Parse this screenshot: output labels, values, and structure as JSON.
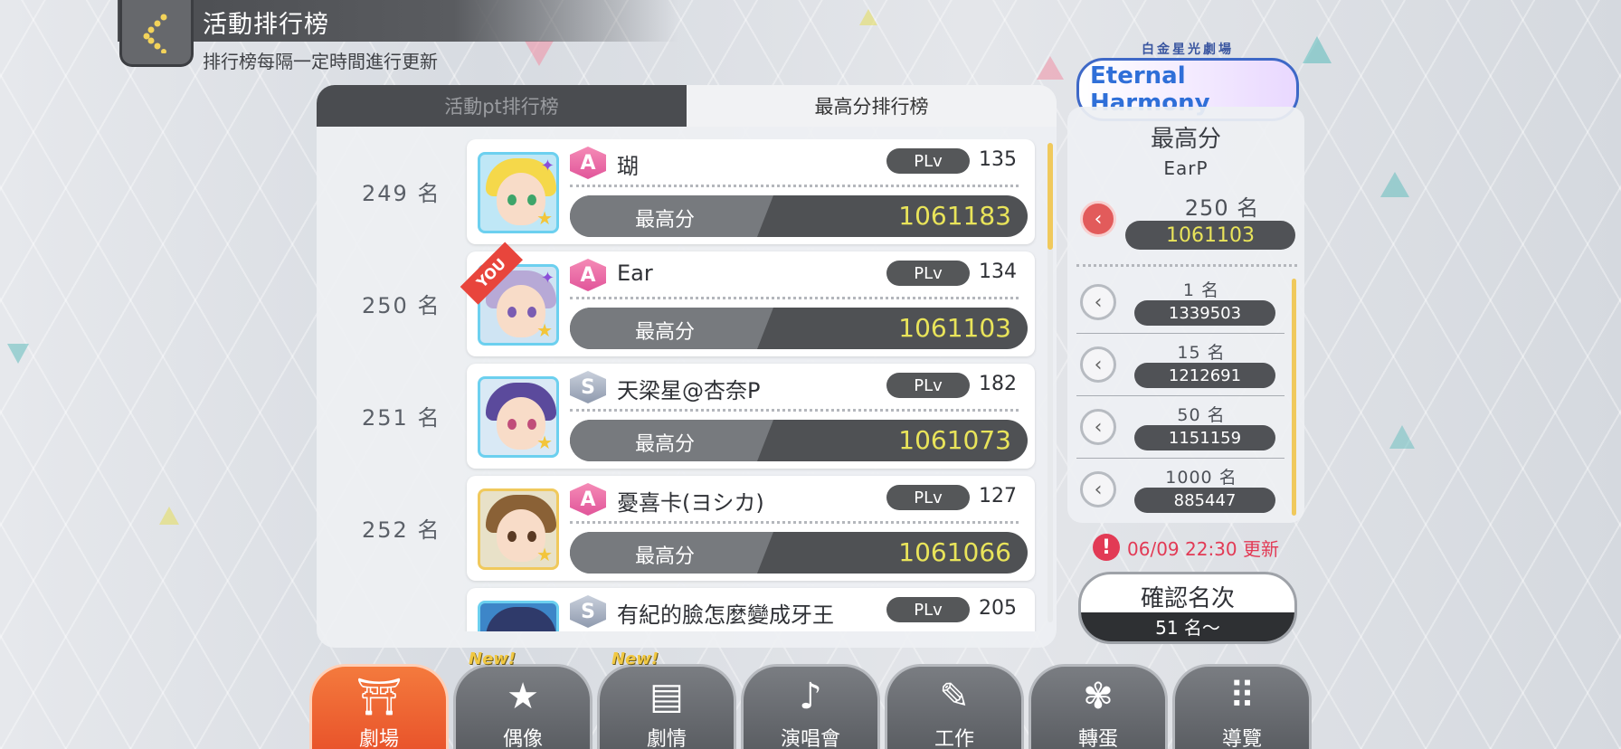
{
  "header": {
    "title": "活動排行榜",
    "subtitle": "排行榜每隔一定時間進行更新"
  },
  "tabs": [
    {
      "label": "活動pt排行榜",
      "active": false
    },
    {
      "label": "最高分排行榜",
      "active": true
    }
  ],
  "rank_rows": [
    {
      "rank": "249 名",
      "badge": "A",
      "name": "瑚",
      "plv_label": "PLv",
      "plv": "135",
      "score_label": "最高分",
      "score": "1061183",
      "you": false,
      "hair": "#f5d84a",
      "eye": "#3da56a"
    },
    {
      "rank": "250 名",
      "badge": "A",
      "name": "Ear",
      "plv_label": "PLv",
      "plv": "134",
      "score_label": "最高分",
      "score": "1061103",
      "you": true,
      "you_label": "YOU",
      "hair": "#b7a9d6",
      "eye": "#7a5cb2"
    },
    {
      "rank": "251 名",
      "badge": "S",
      "name": "天梁星@杏奈P",
      "plv_label": "PLv",
      "plv": "182",
      "score_label": "最高分",
      "score": "1061073",
      "you": false,
      "hair": "#5b4a9c",
      "eye": "#c04d7a"
    },
    {
      "rank": "252 名",
      "badge": "A",
      "name": "憂喜卡(ヨシカ)",
      "plv_label": "PLv",
      "plv": "127",
      "score_label": "最高分",
      "score": "1061066",
      "you": false,
      "hair": "#8a6136",
      "eye": "#5a3a24"
    },
    {
      "rank": "",
      "badge": "S",
      "name": "有紀的臉怎麼變成牙王",
      "plv_label": "PLv",
      "plv": "205",
      "score_label": "最高分",
      "score": "",
      "you": false,
      "hair": "#2f3a6a",
      "eye": "#2a2a2a"
    }
  ],
  "event": {
    "logo_sub": "白金星光劇場",
    "logo_main": "Eternal Harmony"
  },
  "right_panel": {
    "title": "最高分",
    "player": "EarP",
    "my_rank": "250 名",
    "my_score": "1061103",
    "borders": [
      {
        "rank": "1 名",
        "score": "1339503"
      },
      {
        "rank": "15 名",
        "score": "1212691"
      },
      {
        "rank": "50 名",
        "score": "1151159"
      },
      {
        "rank": "1000 名",
        "score": "885447"
      }
    ]
  },
  "update_note": "06/09 22:30 更新",
  "confirm": {
    "label": "確認名次",
    "sub": "51 名～"
  },
  "nav": [
    {
      "label": "劇場",
      "icon": "theater-icon",
      "glyph": "⛩",
      "active": true,
      "new": false
    },
    {
      "label": "偶像",
      "icon": "idol-icon",
      "glyph": "★",
      "active": false,
      "new": true
    },
    {
      "label": "劇情",
      "icon": "story-icon",
      "glyph": "▤",
      "active": false,
      "new": true
    },
    {
      "label": "演唱會",
      "icon": "music-note-icon",
      "glyph": "♪",
      "active": false,
      "new": false
    },
    {
      "label": "工作",
      "icon": "work-icon",
      "glyph": "✎",
      "active": false,
      "new": false
    },
    {
      "label": "轉蛋",
      "icon": "gacha-icon",
      "glyph": "✾",
      "active": false,
      "new": false
    },
    {
      "label": "導覽",
      "icon": "menu-grid-icon",
      "glyph": "⠿",
      "active": false,
      "new": false
    }
  ],
  "new_label": "New!",
  "colors": {
    "accent_orange": "#e8522a",
    "score_yellow": "#e9e45a",
    "alert_red": "#e23a55"
  }
}
